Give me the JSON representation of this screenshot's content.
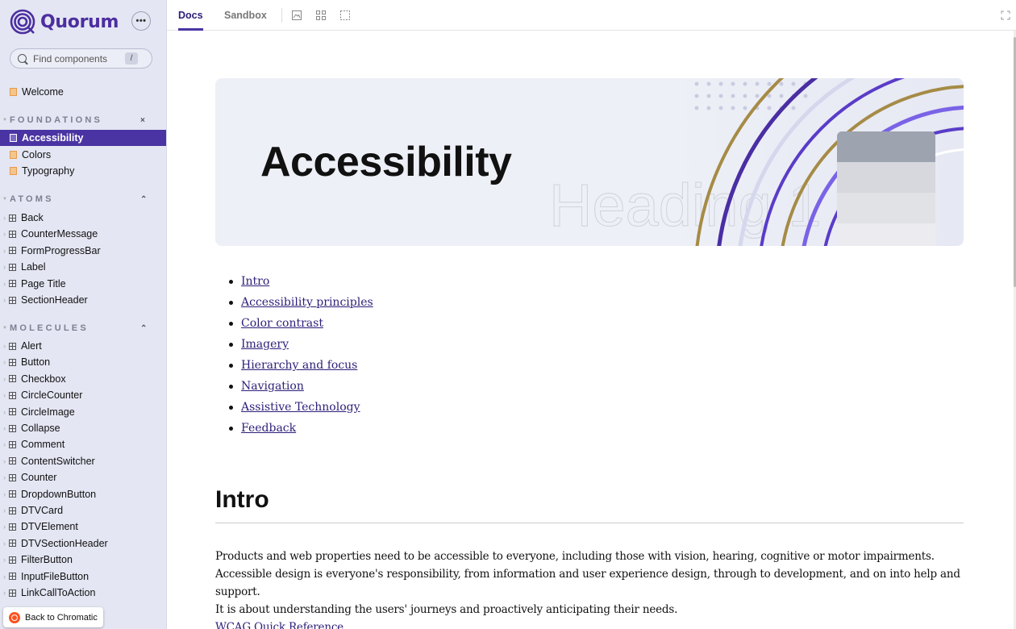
{
  "brand": {
    "name": "Quorum",
    "menu_label": "•••"
  },
  "search": {
    "placeholder": "Find components",
    "shortcut": "/"
  },
  "sidebar": {
    "welcome": "Welcome",
    "groups": {
      "foundations": {
        "label": "FOUNDATIONS",
        "toggle": "×"
      },
      "atoms": {
        "label": "ATOMS",
        "toggle": "⌃"
      },
      "molecules": {
        "label": "MOLECULES",
        "toggle": "⌃"
      }
    },
    "foundations_items": [
      "Accessibility",
      "Colors",
      "Typography"
    ],
    "atoms_items": [
      "Back",
      "CounterMessage",
      "FormProgressBar",
      "Label",
      "Page Title",
      "SectionHeader"
    ],
    "molecules_items": [
      "Alert",
      "Button",
      "Checkbox",
      "CircleCounter",
      "CircleImage",
      "Collapse",
      "Comment",
      "ContentSwitcher",
      "Counter",
      "DropdownButton",
      "DTVCard",
      "DTVElement",
      "DTVSectionHeader",
      "FilterButton",
      "InputFileButton",
      "LinkCallToAction"
    ],
    "active_item": "Accessibility"
  },
  "back_badge": {
    "label": "Back to Chromatic"
  },
  "toolbar": {
    "tabs": [
      "Docs",
      "Sandbox"
    ],
    "active_tab": "Docs"
  },
  "hero": {
    "title": "Accessibility",
    "watermark": "Heading 1"
  },
  "toc": [
    "Intro",
    "Accessibility principles",
    "Color contrast",
    "Imagery",
    "Hierarchy and focus",
    "Navigation",
    "Assistive Technology",
    "Feedback"
  ],
  "intro": {
    "heading": "Intro",
    "lines": [
      "Products and web properties need to be accessible to everyone, including those with vision, hearing, cognitive or motor impairments.",
      "Accessible design is everyone's responsibility, from information and user experience design, through to development, and on into help and support.",
      "It is about understanding the users' journeys and proactively anticipating their needs."
    ],
    "link": "WCAG Quick Reference"
  },
  "colors": {
    "accent": "#4a34a3",
    "link": "#2c1f78",
    "sidebar_bg": "#e4e6f3"
  }
}
